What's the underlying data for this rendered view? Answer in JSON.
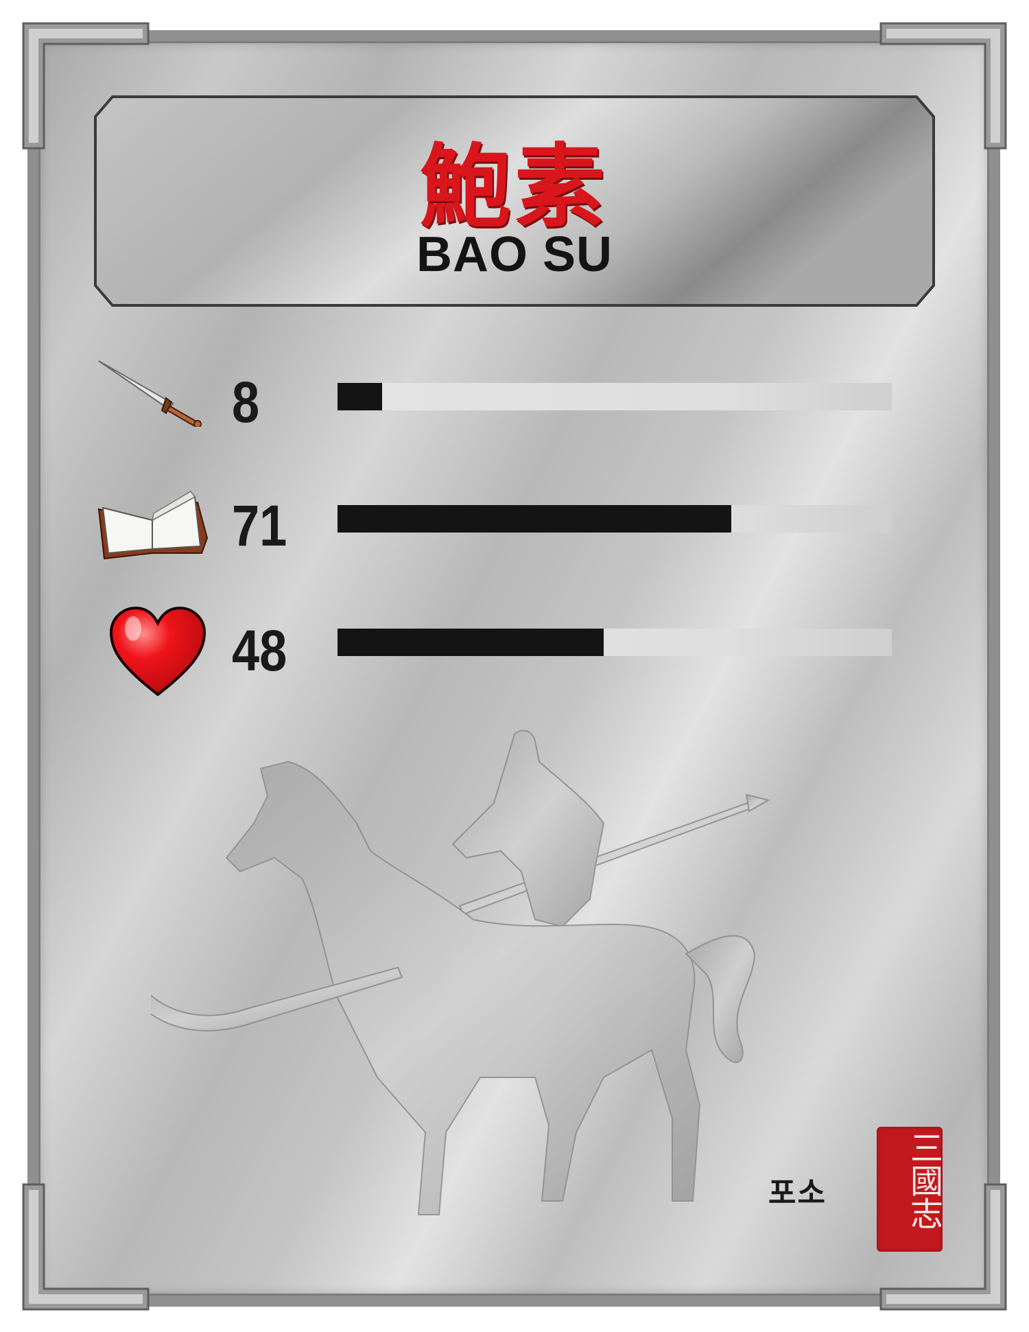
{
  "character": {
    "name_chinese": "鮑素",
    "name_english": "BAO SU",
    "name_korean": "포소"
  },
  "seal": {
    "text": "三國志"
  },
  "stats": [
    {
      "icon": "sword-icon",
      "value": "8",
      "level": 8
    },
    {
      "icon": "book-icon",
      "value": "71",
      "level": 71
    },
    {
      "icon": "heart-icon",
      "value": "48",
      "level": 48
    }
  ],
  "stat_max": 100,
  "colors": {
    "name_red": "#d8161b",
    "bar_fill": "#141414",
    "bar_track": "#e4e4e4",
    "seal_red": "#c2181e"
  }
}
